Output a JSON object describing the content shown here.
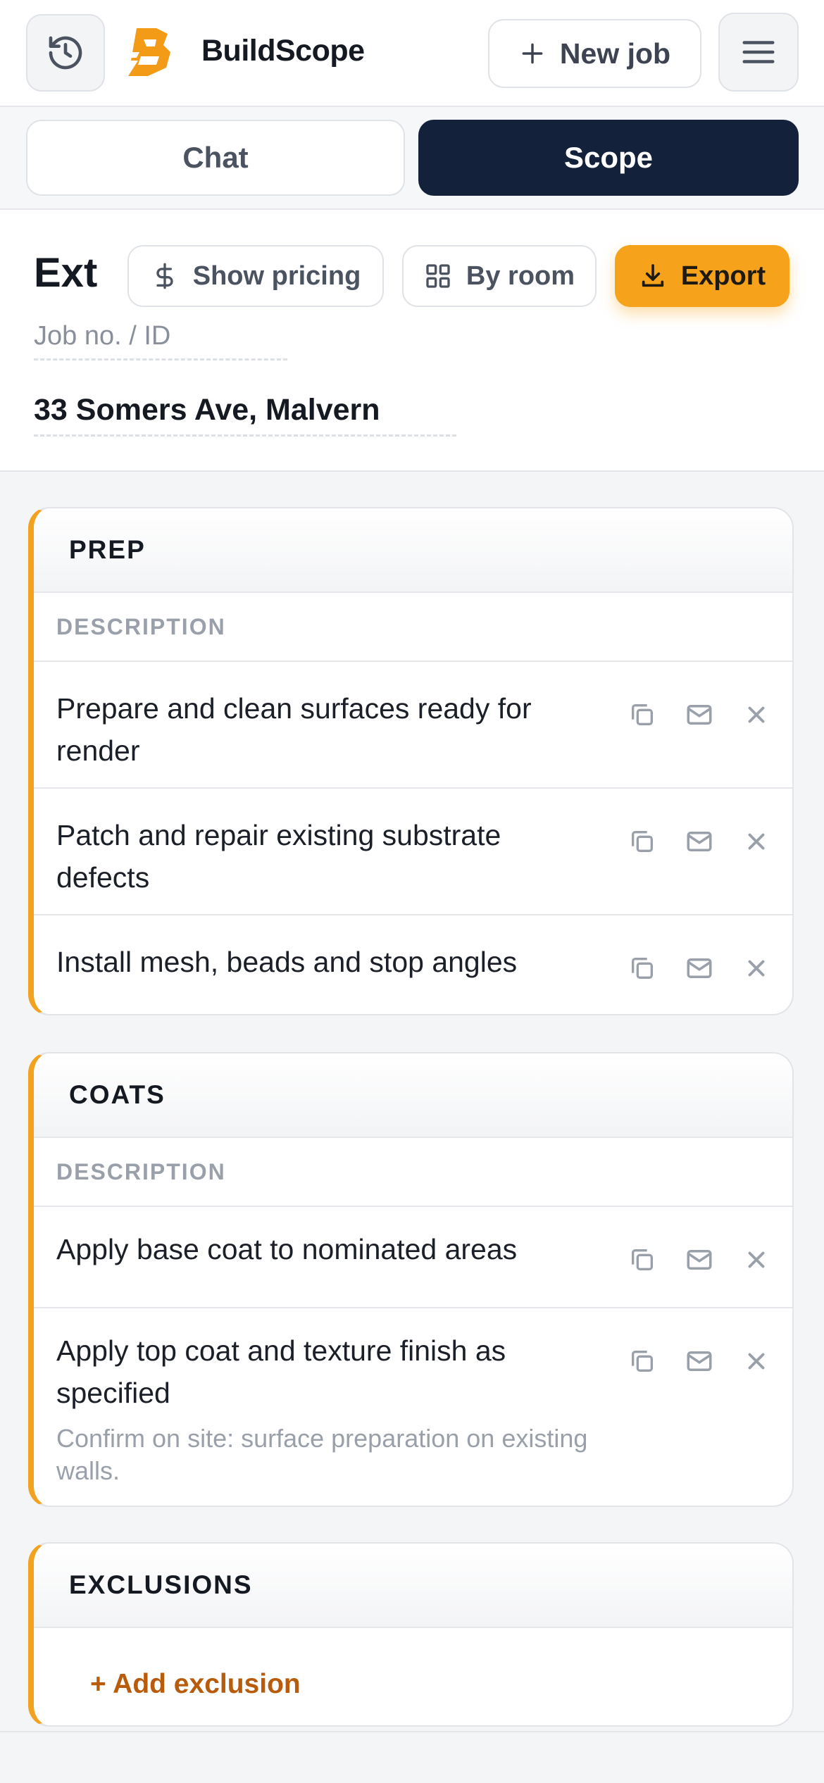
{
  "app": {
    "brand": "BuildScope",
    "new_job_label": "New job",
    "accent_color": "#f7a21b",
    "dark_color": "#14213a"
  },
  "tabs": {
    "chat": "Chat",
    "scope": "Scope",
    "active": "Scope"
  },
  "job": {
    "title": "Exterior render",
    "title_visible": "Ext",
    "job_no_placeholder": "Job no. / ID",
    "address": "33 Somers Ave, Malvern",
    "show_pricing_label": "Show pricing",
    "by_room_label": "By room",
    "export_label": "Export"
  },
  "sections": {
    "prep": {
      "title": "PREP",
      "column": "DESCRIPTION",
      "items": [
        {
          "text": "Prepare and clean surfaces ready for render"
        },
        {
          "text": "Patch and repair existing substrate defects"
        },
        {
          "text": "Install mesh, beads and stop angles"
        }
      ]
    },
    "coats": {
      "title": "COATS",
      "column": "DESCRIPTION",
      "items": [
        {
          "text": "Apply base coat to nominated areas"
        },
        {
          "text": "Apply top coat and texture finish as specified",
          "note": "Confirm on site: surface preparation on existing walls."
        }
      ]
    },
    "exclusions": {
      "title": "EXCLUSIONS",
      "add_label": "+ Add exclusion"
    }
  },
  "icons": {
    "history": "history-icon",
    "logo": "buildscope-logo",
    "plus": "plus-icon",
    "menu": "hamburger-icon",
    "dollar": "dollar-icon",
    "grid": "grid-icon",
    "download": "download-icon",
    "copy": "copy-icon",
    "mail": "mail-icon",
    "close": "close-icon"
  }
}
